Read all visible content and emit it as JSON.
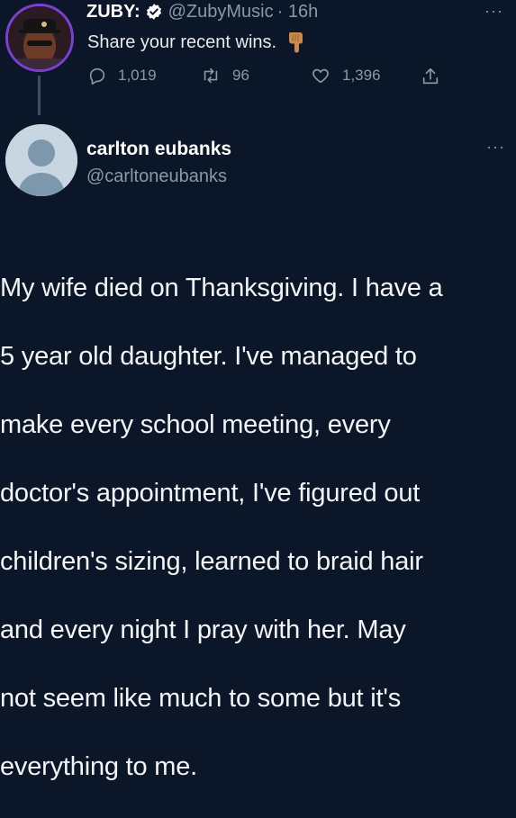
{
  "tweet": {
    "author": {
      "name": "ZUBY:",
      "handle": "@ZubyMusic",
      "time": "· 16h",
      "verified": true
    },
    "text": "Share your recent wins.",
    "emoji": "backhand-index-pointing-down",
    "more_label": "···",
    "actions": {
      "replies": "1,019",
      "retweets": "96",
      "likes": "1,396"
    }
  },
  "reply": {
    "author": {
      "name": "carlton eubanks",
      "handle": "@carltoneubanks"
    },
    "more_label": "···",
    "text_lines": [
      "My wife died on Thanksgiving. I have a",
      "5 year old daughter. I've managed to",
      "make every school meeting, every",
      "doctor's appointment, I've figured out",
      "children's sizing, learned to braid hair",
      "and every night I pray with her. May",
      "not seem like much to some but it's",
      "everything to me."
    ]
  },
  "colors": {
    "background": "#0b1628",
    "verified": "#1d9bf0",
    "muted": "#8b98a5",
    "avatar_ring": "#7b3fd1"
  }
}
